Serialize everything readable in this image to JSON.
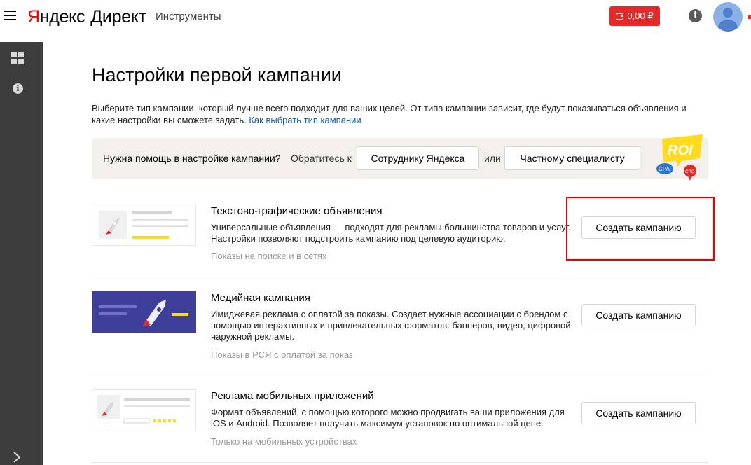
{
  "header": {
    "logo_y": "Я",
    "logo_rest": "ндекс",
    "logo_product": "Директ",
    "tools_label": "Инструменты",
    "balance": "0,00 ₽",
    "info_icon": "info-icon",
    "avatar_icon": "user-avatar"
  },
  "sidebar": {
    "icons": [
      "dashboard-grid-icon",
      "info-icon",
      "chevron-right-icon"
    ]
  },
  "page": {
    "title": "Настройки первой кампании",
    "intro_text": "Выберите тип кампании, который лучше всего подходит для ваших целей. От типа кампании зависит, где будут показываться объявления и какие настройки вы сможете задать.",
    "intro_link": "Как выбрать тип кампании"
  },
  "help": {
    "question": "Нужна помощь в настройке кампании?",
    "contact": "Обратитесь к",
    "employee_button": "Сотруднику Яндекса",
    "or": "или",
    "specialist_button": "Частному специалисту",
    "badge_roi": "ROI",
    "badge_cpa": "CPA",
    "badge_cpc": "CPC"
  },
  "campaigns": [
    {
      "title": "Текстово-графические объявления",
      "description": "Универсальные объявления — подходят для рекламы большинства товаров и услуг. Настройки позволяют подстроить кампанию под целевую аудиторию.",
      "meta": "Показы на поиске и в сетях",
      "button": "Создать кампанию"
    },
    {
      "title": "Медийная кампания",
      "description": "Имиджевая реклама с оплатой за показы. Создает нужные ассоциации с брендом с помощью интерактивных и привлекательных форматов: баннеров, видео, цифровой наружной рекламы.",
      "meta": "Показы в РСЯ с оплатой за показ",
      "button": "Создать кампанию"
    },
    {
      "title": "Реклама мобильных приложений",
      "description": "Формат объявлений, с помощью которого можно продвигать ваши приложения для iOS и Android. Позволяет получить максимум установок по оптимальной цене.",
      "meta": "Только на мобильных устройствах",
      "button": "Создать кампанию"
    }
  ],
  "colors": {
    "accent_red": "#e32a2a",
    "link_blue": "#0a5fb5",
    "sidebar_bg": "#3d3d3d",
    "help_bg": "#f3f0eb",
    "highlight": "#e80000",
    "media_thumb": "#3d3f9a",
    "yellow": "#ffdb1f"
  }
}
